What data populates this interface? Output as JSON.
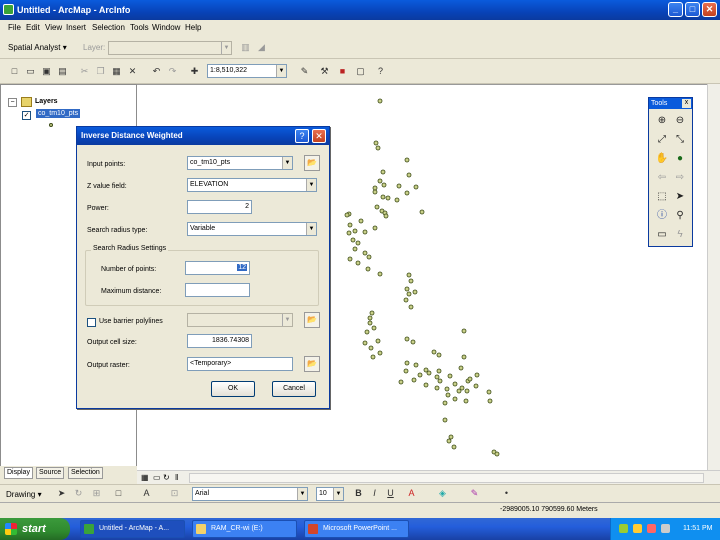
{
  "window": {
    "title": "Untitled - ArcMap - ArcInfo",
    "minimize": "_",
    "maximize": "□",
    "close": "✕"
  },
  "menu": [
    "File",
    "Edit",
    "View",
    "Insert",
    "Selection",
    "Tools",
    "Window",
    "Help"
  ],
  "toolbar1": {
    "spatial_analyst_label": "Spatial Analyst ▾",
    "layer_label": "Layer:",
    "layer_value": ""
  },
  "toolbar2": {
    "scale_value": "1:8,510,322"
  },
  "toc": {
    "root_label": "Layers",
    "layer_label": "co_tm10_pts",
    "tabs": [
      "Display",
      "Source",
      "Selection"
    ]
  },
  "tools_palette": {
    "title": "Tools",
    "close": "x",
    "icons": [
      "zoom-in-icon",
      "zoom-out-icon",
      "fixed-zoom-in-icon",
      "fixed-zoom-out-icon",
      "pan-icon",
      "full-extent-icon",
      "back-extent-icon",
      "forward-extent-icon",
      "select-features-icon",
      "select-elements-icon",
      "identify-icon",
      "find-icon",
      "measure-icon",
      "hyperlink-icon"
    ]
  },
  "dialog": {
    "title": "Inverse Distance Weighted",
    "help": "?",
    "close": "✕",
    "input_points_label": "Input points:",
    "input_points_value": "co_tm10_pts",
    "z_value_field_label": "Z value field:",
    "z_value_field_value": "ELEVATION",
    "power_label": "Power:",
    "power_value": "2",
    "search_radius_type_label": "Search radius type:",
    "search_radius_type_value": "Variable",
    "search_group_title": "Search Radius Settings",
    "number_of_points_label": "Number of points:",
    "number_of_points_value": "12",
    "max_distance_label": "Maximum distance:",
    "max_distance_value": "",
    "barrier_label": "Use barrier polylines",
    "barrier_checked": false,
    "barrier_value": "",
    "cell_size_label": "Output cell size:",
    "cell_size_value": "1836.74308",
    "output_raster_label": "Output raster:",
    "output_raster_value": "<Temporary>",
    "ok_label": "OK",
    "cancel_label": "Cancel"
  },
  "drawing_toolbar": {
    "drawing_label": "Drawing ▾",
    "font_value": "Arial",
    "size_value": "10",
    "bold": "B",
    "italic": "I",
    "underline": "U"
  },
  "status": {
    "coordinates": "-2989005.10  790599.60 Meters"
  },
  "taskbar": {
    "start_label": "start",
    "items": [
      "Untitled - ArcMap - A...",
      "RAM_CR-wi (E:)",
      "Microsoft PowerPoint ..."
    ],
    "clock": "11:51 PM"
  },
  "colors": {
    "titlebar": "#0a5bdc",
    "point_fill": "#c9d08a",
    "point_stroke": "#3b4a16",
    "taskbar": "#245edb",
    "start": "#2f8a2f"
  }
}
